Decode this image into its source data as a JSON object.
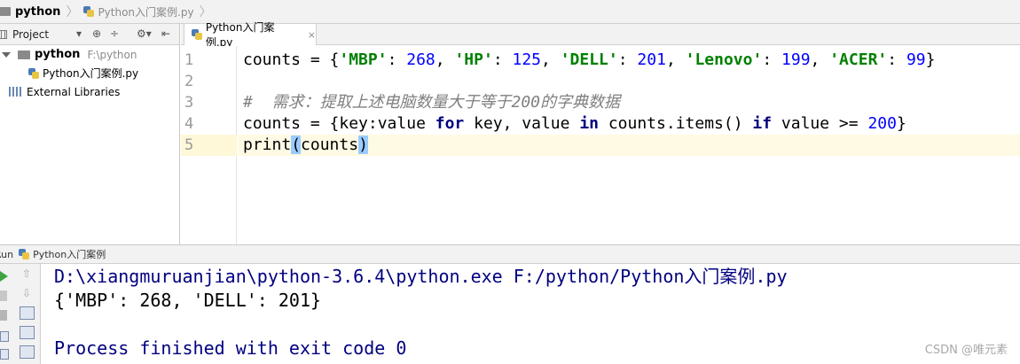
{
  "breadcrumb": {
    "root": "python",
    "file": "Python入门案例.py"
  },
  "project_panel": {
    "title": "Project",
    "root_name": "python",
    "root_path": "F:\\python",
    "file": "Python入门案例.py",
    "external_libraries": "External Libraries"
  },
  "editor": {
    "tab_label": "Python入门案例.py",
    "line_numbers": [
      "1",
      "2",
      "3",
      "4",
      "5"
    ],
    "lines": [
      "counts = {'MBP': 268, 'HP': 125, 'DELL': 201, 'Lenovo': 199, 'ACER': 99}",
      "",
      "#  需求：提取上述电脑数量大于等于200的字典数据",
      "counts = {key:value for key, value in counts.items() if value >= 200}",
      "print(counts)"
    ]
  },
  "run": {
    "label": "Run",
    "config": "Python入门案例",
    "console_lines": [
      "D:\\xiangmuruanjian\\python-3.6.4\\python.exe F:/python/Python入门案例.py",
      "{'MBP': 268, 'DELL': 201}",
      "",
      "Process finished with exit code 0"
    ]
  },
  "watermark": "CSDN @唯元素",
  "colors": {
    "string": "#008000",
    "number": "#0000ff",
    "keyword": "#000080",
    "comment": "#808080",
    "current_line": "#fffae3",
    "console_command": "#000080"
  },
  "icons": [
    "folder-icon",
    "python-file-icon",
    "library-icon",
    "run-icon",
    "stop-icon",
    "gear-icon",
    "target-icon"
  ]
}
